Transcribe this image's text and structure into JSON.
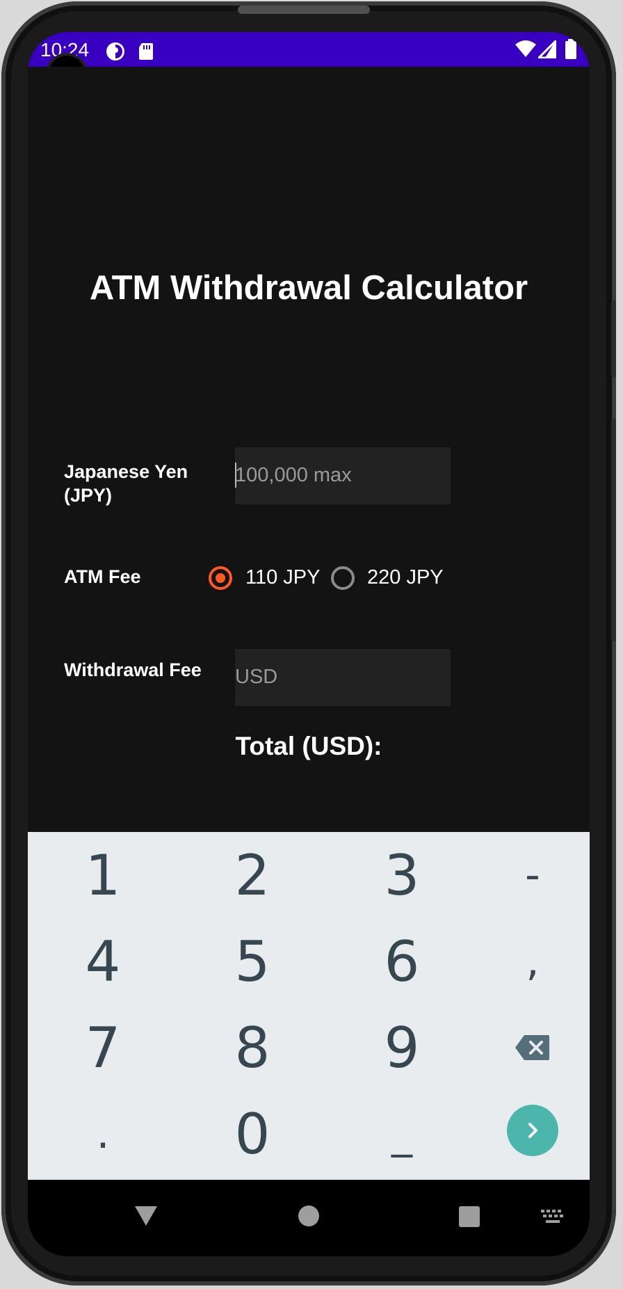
{
  "status_bar": {
    "time": "10:24"
  },
  "app": {
    "title": "ATM Withdrawal Calculator",
    "jpy": {
      "label": "Japanese Yen (JPY)",
      "placeholder": "100,000 max"
    },
    "atm_fee": {
      "label": "ATM Fee",
      "options": [
        {
          "label": "110 JPY",
          "selected": true
        },
        {
          "label": "220 JPY",
          "selected": false
        }
      ]
    },
    "withdrawal_fee": {
      "label": "Withdrawal Fee",
      "placeholder": "USD"
    },
    "total_label": "Total (USD):"
  },
  "keyboard": {
    "keys": [
      "1",
      "2",
      "3",
      "-",
      "4",
      "5",
      "6",
      ",",
      "7",
      "8",
      "9",
      ".",
      "0",
      "_"
    ],
    "delete_icon": "backspace-icon",
    "go_icon": "chevron-right-icon"
  },
  "colors": {
    "status_bar": "#3a00c2",
    "background": "#131313",
    "accent": "#ff5a1f",
    "keyboard_bg": "#e8ecef",
    "go_button": "#4db6ac"
  }
}
